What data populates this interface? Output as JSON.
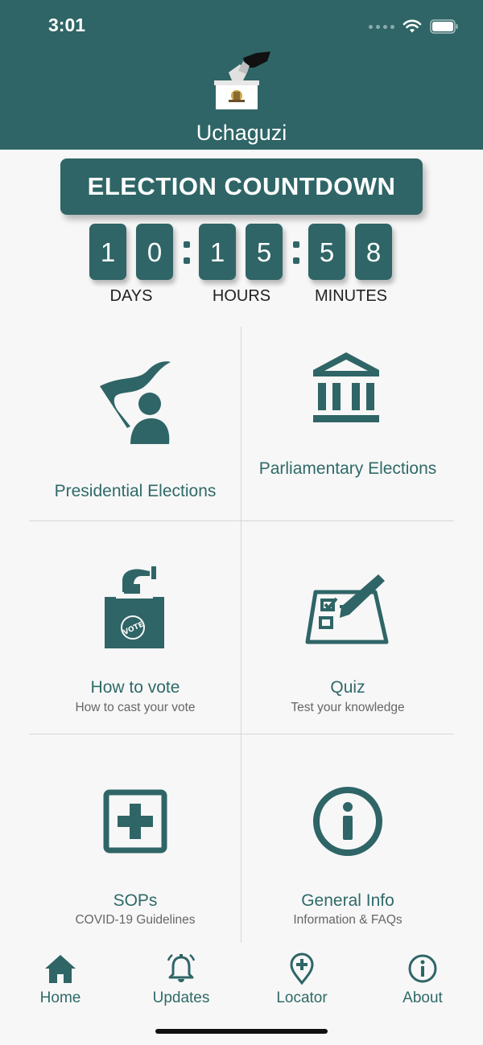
{
  "status_bar": {
    "time": "3:01"
  },
  "header": {
    "title": "Uchaguzi"
  },
  "countdown": {
    "title": "ELECTION COUNTDOWN",
    "days_digits": [
      "1",
      "0"
    ],
    "hours_digits": [
      "1",
      "5"
    ],
    "minutes_digits": [
      "5",
      "8"
    ],
    "labels": {
      "days": "DAYS",
      "hours": "HOURS",
      "minutes": "MINUTES"
    }
  },
  "tiles": [
    {
      "title": "Presidential Elections",
      "subtitle": "",
      "icon": "flag-person-icon"
    },
    {
      "title": "Parliamentary Elections",
      "subtitle": "",
      "icon": "parliament-building-icon"
    },
    {
      "title": "How to vote",
      "subtitle": "How to cast your vote",
      "icon": "ballot-box-icon"
    },
    {
      "title": "Quiz",
      "subtitle": "Test your knowledge",
      "icon": "checklist-pencil-icon"
    },
    {
      "title": "SOPs",
      "subtitle": "COVID-19 Guidelines",
      "icon": "plus-square-icon"
    },
    {
      "title": "General Info",
      "subtitle": "Information & FAQs",
      "icon": "info-circle-icon"
    }
  ],
  "tabbar": {
    "items": [
      {
        "label": "Home",
        "icon": "home-icon"
      },
      {
        "label": "Updates",
        "icon": "bell-icon"
      },
      {
        "label": "Locator",
        "icon": "location-plus-icon"
      },
      {
        "label": "About",
        "icon": "info-icon"
      }
    ]
  },
  "colors": {
    "primary": "#2f6566",
    "background": "#f7f7f7",
    "divider": "#d6d6d6"
  }
}
